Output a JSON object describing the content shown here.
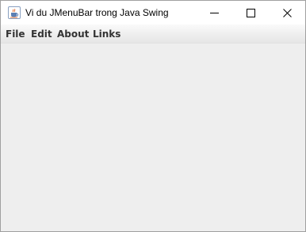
{
  "window": {
    "title": "Vi du JMenuBar trong Java Swing",
    "icon": "java-coffee-icon",
    "controls": [
      "minimize-icon",
      "maximize-icon",
      "close-icon"
    ]
  },
  "menubar": {
    "items": [
      {
        "label": "File"
      },
      {
        "label": "Edit"
      },
      {
        "label": "About"
      },
      {
        "label": "Links"
      }
    ]
  },
  "colors": {
    "title_background": "#ffffff",
    "content_background": "#eeeeee",
    "menu_text": "#333333"
  }
}
